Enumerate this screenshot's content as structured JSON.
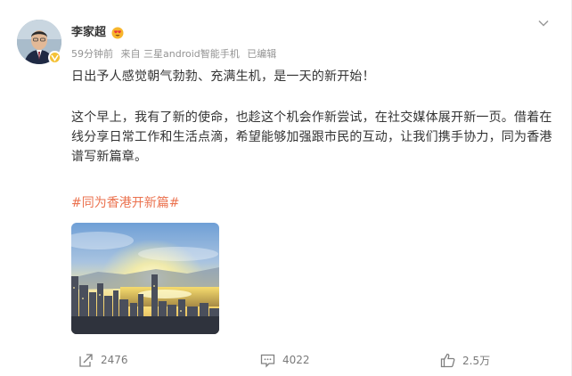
{
  "post": {
    "author_name": "李家超",
    "meta": {
      "time": "59分钟前",
      "source": "来自 三星android智能手机",
      "edited": "已编辑"
    },
    "paragraphs": [
      "日出予人感觉朝气勃勃、充满生机，是一天的新开始！",
      "这个早上，我有了新的使命，也趁这个机会作新尝试，在社交媒体展开新一页。借着在线分享日常工作和生活点滴，希望能够加强跟市民的互动，让我们携手协力，同为香港谱写新篇章。"
    ],
    "hashtag": "#同为香港开新篇#",
    "image_alt": "sunrise-over-hong-kong-harbour-photo"
  },
  "actions": {
    "share_count": "2476",
    "comment_count": "4022",
    "like_count": "2.5万"
  },
  "icons": {
    "more": "chevron-down-icon",
    "share": "share-icon",
    "comment": "comment-icon",
    "like": "thumbs-up-icon",
    "verified": "verified-badge-icon",
    "member": "heart-eyes-badge-icon"
  },
  "colors": {
    "hashtag": "#eb7350",
    "meta_text": "#939393",
    "verified_badge": "#f4c136"
  }
}
